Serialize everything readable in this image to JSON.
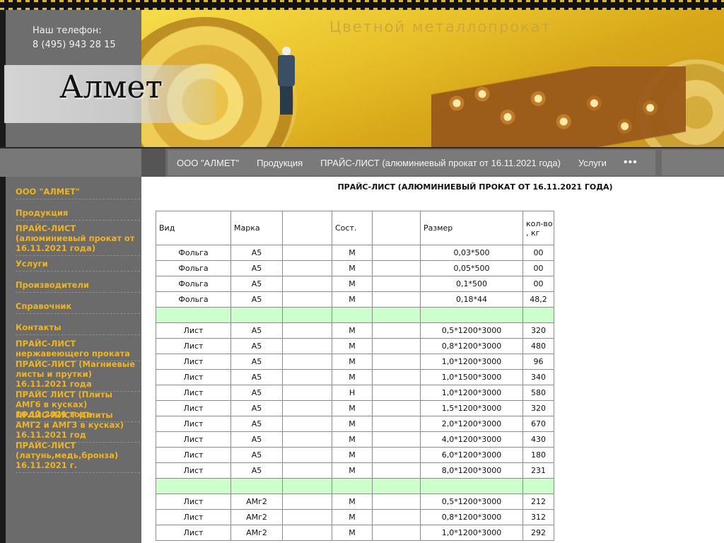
{
  "header": {
    "phone_label": "Наш телефон:",
    "phone_number": "8 (495) 943 28 15",
    "logo": "Алмет",
    "tagline": "Цветной металлопрокат"
  },
  "nav": {
    "items": [
      "ООО \"АЛМЕТ\"",
      "Продукция",
      "ПРАЙС-ЛИСТ (алюминиевый прокат от 16.11.2021 года)",
      "Услуги"
    ],
    "more": "•••"
  },
  "sidebar": {
    "items": [
      "ООО \"АЛМЕТ\"",
      "Продукция",
      "ПРАЙС-ЛИСТ (алюминиевый прокат от 16.11.2021 года)",
      "Услуги",
      "Производители",
      "Справочник",
      "Контакты",
      "ПРАЙС-ЛИСТ нержавеющего проката",
      "ПРАЙС-ЛИСТ (Магниевые листы и прутки) 16.11.2021 года",
      "ПРАЙС ЛИСТ (Плиты АМГ6 в кусках) 16.11.2021 года",
      "ПРАЙС-ЛИСТ (Плиты АМГ2 и АМГ3 в кусках) 16.11.2021 год",
      "ПРАЙС-ЛИСТ (латунь,медь,бронза) 16.11.2021 г."
    ]
  },
  "page_title": "ПРАЙС-ЛИСТ (АЛЮМИНИЕВЫЙ ПРОКАТ ОТ 16.11.2021 ГОДА)",
  "table": {
    "headers": [
      "Вид",
      "Марка",
      "",
      "Сост.",
      "",
      "Размер",
      "кол-во , кг"
    ],
    "rows": [
      [
        "Фольга",
        "А5",
        "",
        "М",
        "",
        "0,03*500",
        "00"
      ],
      [
        "Фольга",
        "А5",
        "",
        "М",
        "",
        "0,05*500",
        "00"
      ],
      [
        "Фольга",
        "А5",
        "",
        "М",
        "",
        "0,1*500",
        "00"
      ],
      [
        "Фольга",
        "А5",
        "",
        "М",
        "",
        "0,18*44",
        "48,2"
      ],
      [
        "",
        "",
        "",
        "",
        "",
        "",
        ""
      ],
      [
        "Лист",
        "А5",
        "",
        "М",
        "",
        "0,5*1200*3000",
        "320"
      ],
      [
        "Лист",
        "А5",
        "",
        "М",
        "",
        "0,8*1200*3000",
        "480"
      ],
      [
        "Лист",
        "А5",
        "",
        "М",
        "",
        "1,0*1200*3000",
        "96"
      ],
      [
        "Лист",
        "А5",
        "",
        "М",
        "",
        "1,0*1500*3000",
        "340"
      ],
      [
        "Лист",
        "А5",
        "",
        "Н",
        "",
        "1,0*1200*3000",
        "580"
      ],
      [
        "Лист",
        "А5",
        "",
        "М",
        "",
        "1,5*1200*3000",
        "320"
      ],
      [
        "Лист",
        "А5",
        "",
        "М",
        "",
        "2,0*1200*3000",
        "670"
      ],
      [
        "Лист",
        "А5",
        "",
        "М",
        "",
        "4,0*1200*3000",
        "430"
      ],
      [
        "Лист",
        "А5",
        "",
        "М",
        "",
        "6,0*1200*3000",
        "180"
      ],
      [
        "Лист",
        "А5",
        "",
        "М",
        "",
        "8,0*1200*3000",
        "231"
      ],
      [
        "",
        "",
        "",
        "",
        "",
        "",
        ""
      ],
      [
        "Лист",
        "АМг2",
        "",
        "М",
        "",
        "0,5*1200*3000",
        "212"
      ],
      [
        "Лист",
        "АМг2",
        "",
        "М",
        "",
        "0,8*1200*3000",
        "312"
      ],
      [
        "Лист",
        "АМг2",
        "",
        "М",
        "",
        "1,0*1200*3000",
        "292"
      ]
    ]
  },
  "colors": {
    "sidebar_link": "#f0b51e",
    "separator_row": "#ccffcc",
    "sidebar_bg": "#6b6b6b"
  }
}
